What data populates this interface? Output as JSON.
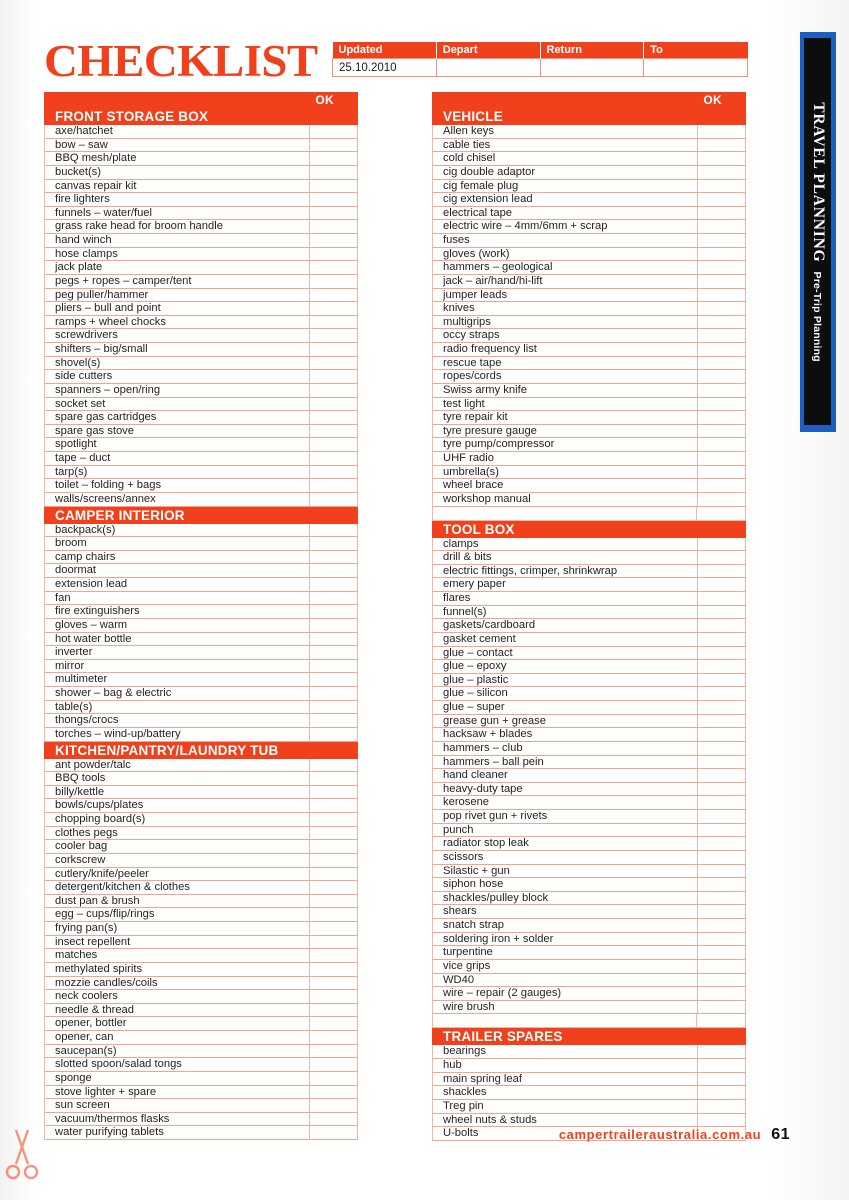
{
  "header": {
    "title": "CHECKLIST",
    "trip_table": {
      "columns": [
        "Updated",
        "Depart",
        "Return",
        "To"
      ],
      "values": [
        "25.10.2010",
        "",
        "",
        ""
      ]
    }
  },
  "ok_label": "OK",
  "side_tab": {
    "title": "TRAVEL PLANNING",
    "subtitle": "Pre-Trip Planning"
  },
  "footer": {
    "url": "campertraileraustralia.com.au",
    "page_number": "61"
  },
  "colors": {
    "red": "#f0411c",
    "rule": "#f5a58e",
    "blue": "#1c5fc0",
    "black": "#0d0d0d"
  },
  "columns": {
    "left": [
      {
        "title": "FRONT STORAGE BOX",
        "has_ok_bar": true,
        "spacer_before": false,
        "items": [
          "axe/hatchet",
          "bow – saw",
          "BBQ mesh/plate",
          "bucket(s)",
          "canvas repair kit",
          "fire lighters",
          "funnels – water/fuel",
          "grass rake head for broom handle",
          "hand winch",
          "hose clamps",
          "jack plate",
          "pegs + ropes – camper/tent",
          "peg puller/hammer",
          "pliers – bull and point",
          "ramps + wheel chocks",
          "screwdrivers",
          "shifters – big/small",
          "shovel(s)",
          "side cutters",
          "spanners – open/ring",
          "socket set",
          "spare gas cartridges",
          "spare gas stove",
          "spotlight",
          "tape – duct",
          "tarp(s)",
          "toilet – folding + bags",
          "walls/screens/annex"
        ]
      },
      {
        "title": "CAMPER INTERIOR",
        "has_ok_bar": false,
        "spacer_before": false,
        "items": [
          "backpack(s)",
          "broom",
          "camp chairs",
          "doormat",
          "extension lead",
          "fan",
          "fire extinguishers",
          "gloves – warm",
          "hot water bottle",
          "inverter",
          "mirror",
          "multimeter",
          "shower – bag & electric",
          "table(s)",
          "thongs/crocs",
          "torches – wind-up/battery"
        ]
      },
      {
        "title": "KITCHEN/PANTRY/LAUNDRY TUB",
        "has_ok_bar": false,
        "spacer_before": false,
        "items": [
          "ant powder/talc",
          "BBQ tools",
          "billy/kettle",
          "bowls/cups/plates",
          "chopping board(s)",
          "clothes pegs",
          "cooler bag",
          "corkscrew",
          "cutlery/knife/peeler",
          "detergent/kitchen & clothes",
          "dust pan & brush",
          "egg – cups/flip/rings",
          "frying pan(s)",
          "insect repellent",
          "matches",
          "methylated spirits",
          "mozzie candles/coils",
          "neck coolers",
          "needle & thread",
          "opener, bottler",
          "opener, can",
          "saucepan(s)",
          "slotted spoon/salad tongs",
          "sponge",
          "stove lighter + spare",
          "sun screen",
          "vacuum/thermos flasks",
          "water purifying tablets"
        ]
      }
    ],
    "right": [
      {
        "title": "VEHICLE",
        "has_ok_bar": true,
        "spacer_before": false,
        "items": [
          "Allen keys",
          "cable ties",
          "cold chisel",
          "cig double adaptor",
          "cig female plug",
          "cig extension lead",
          "electrical tape",
          "electric wire – 4mm/6mm + scrap",
          "fuses",
          "gloves (work)",
          "hammers – geological",
          "jack – air/hand/hi-lift",
          "jumper leads",
          "knives",
          "multigrips",
          "occy straps",
          "radio frequency list",
          "rescue tape",
          "ropes/cords",
          "Swiss army knife",
          "test light",
          "tyre repair kit",
          "tyre presure gauge",
          "tyre pump/compressor",
          "UHF radio",
          "umbrella(s)",
          "wheel brace",
          "workshop manual"
        ]
      },
      {
        "title": "TOOL BOX",
        "has_ok_bar": false,
        "spacer_before": true,
        "items": [
          "clamps",
          "drill & bits",
          "electric fittings, crimper, shrinkwrap",
          "emery paper",
          "flares",
          "funnel(s)",
          "gaskets/cardboard",
          "gasket cement",
          "glue – contact",
          "glue – epoxy",
          "glue – plastic",
          "glue – silicon",
          "glue – super",
          "grease gun + grease",
          "hacksaw + blades",
          "hammers – club",
          "hammers – ball pein",
          "hand cleaner",
          "heavy-duty tape",
          "kerosene",
          "pop rivet gun + rivets",
          "punch",
          "radiator stop leak",
          "scissors",
          "Silastic + gun",
          "siphon hose",
          "shackles/pulley block",
          "shears",
          "snatch strap",
          "soldering iron + solder",
          "turpentine",
          "vice grips",
          "WD40",
          "wire – repair (2 gauges)",
          "wire brush"
        ]
      },
      {
        "title": "TRAILER SPARES",
        "has_ok_bar": false,
        "spacer_before": true,
        "items": [
          "bearings",
          "hub",
          "main spring leaf",
          "shackles",
          "Treg pin",
          "wheel nuts & studs",
          "U-bolts"
        ]
      }
    ]
  }
}
